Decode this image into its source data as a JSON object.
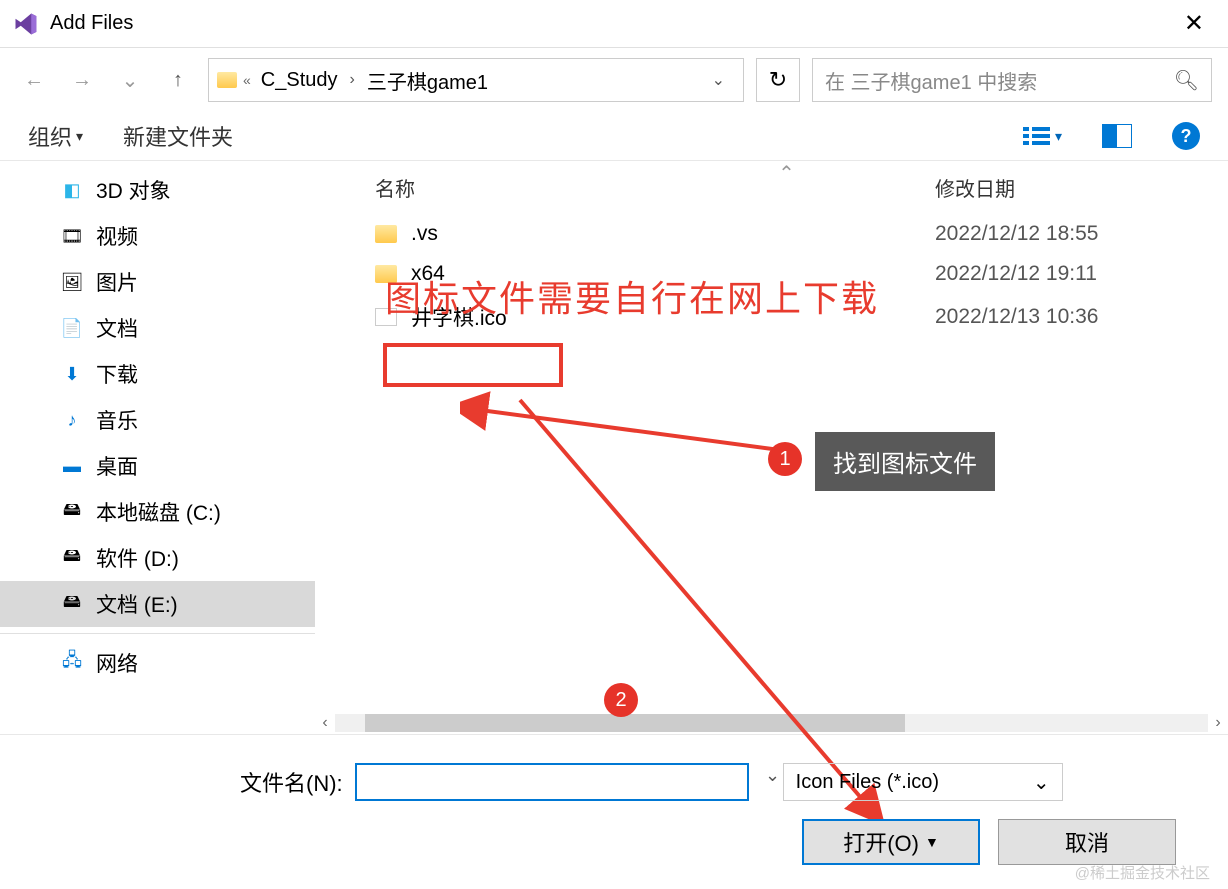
{
  "window": {
    "title": "Add Files"
  },
  "breadcrumb": {
    "seg1": "C_Study",
    "seg2": "三子棋game1"
  },
  "search": {
    "placeholder": "在 三子棋game1 中搜索"
  },
  "toolbar": {
    "organize": "组织",
    "new_folder": "新建文件夹"
  },
  "columns": {
    "name": "名称",
    "modified": "修改日期"
  },
  "sidebar": {
    "items": [
      {
        "label": "3D 对象"
      },
      {
        "label": "视频"
      },
      {
        "label": "图片"
      },
      {
        "label": "文档"
      },
      {
        "label": "下载"
      },
      {
        "label": "音乐"
      },
      {
        "label": "桌面"
      },
      {
        "label": "本地磁盘 (C:)"
      },
      {
        "label": "软件 (D:)"
      },
      {
        "label": "文档 (E:)"
      },
      {
        "label": "网络"
      }
    ]
  },
  "files": [
    {
      "name": ".vs",
      "date": "2022/12/12 18:55",
      "type": "folder"
    },
    {
      "name": "x64",
      "date": "2022/12/12 19:11",
      "type": "folder"
    },
    {
      "name": "井字棋.ico",
      "date": "2022/12/13 10:36",
      "type": "file"
    }
  ],
  "annotations": {
    "red_text": "图标文件需要自行在网上下载",
    "badge1": "1",
    "badge2": "2",
    "callout": "找到图标文件"
  },
  "bottom": {
    "filename_label": "文件名(N):",
    "filetype": "Icon Files (*.ico)",
    "open": "打开(O)",
    "cancel": "取消"
  },
  "watermark": "@稀土掘金技术社区"
}
